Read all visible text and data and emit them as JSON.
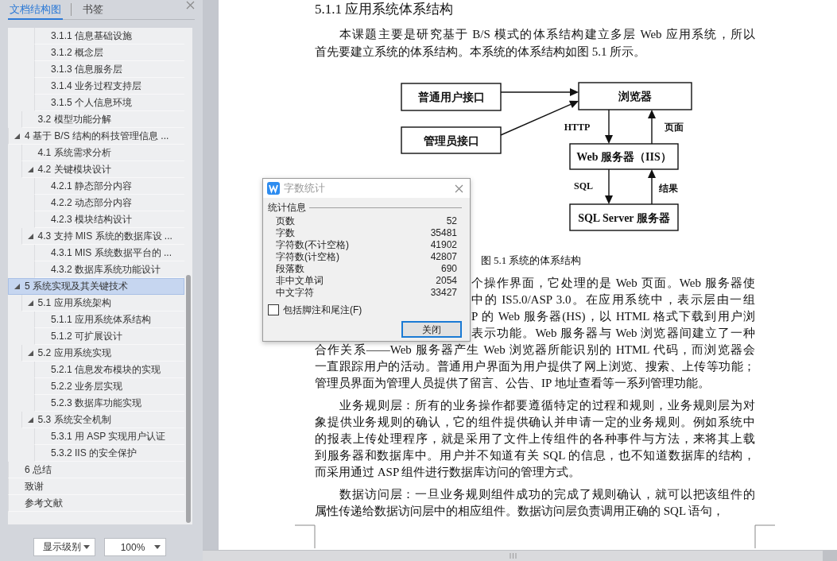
{
  "sidebar": {
    "tabs": [
      {
        "label": "文档结构图",
        "selected": true
      },
      {
        "label": "书签",
        "selected": false
      }
    ],
    "tree": [
      {
        "children": [
          {
            "children": [
              {
                "label": "3.1.1  信息基础设施",
                "selected": false
              },
              {
                "label": "3.1.2  概念层",
                "selected": false
              },
              {
                "label": "3.1.3  信息服务层",
                "selected": false
              },
              {
                "label": "3.1.4  业务过程支持层",
                "selected": false
              },
              {
                "label": "3.1.5  个人信息环境",
                "selected": false
              }
            ]
          },
          {
            "label": "3.2 模型功能分解",
            "selected": false
          }
        ]
      },
      {
        "label": "4  基于 B/S 结构的科技管理信息 ...",
        "selected": false,
        "expanded": true,
        "children": [
          {
            "label": "4.1  系统需求分析",
            "selected": false
          },
          {
            "label": "4.2  关键模块设计",
            "selected": false,
            "expanded": true,
            "children": [
              {
                "label": "4.2.1  静态部分内容",
                "selected": false
              },
              {
                "label": "4.2.2  动态部分内容",
                "selected": false
              },
              {
                "label": "4.2.3  模块结构设计",
                "selected": false
              }
            ]
          },
          {
            "label": "4.3  支持 MIS 系统的数据库设 ...",
            "selected": false,
            "expanded": true,
            "children": [
              {
                "label": "4.3.1 MIS 系统数据平台的 ...",
                "selected": false
              },
              {
                "label": "4.3.2  数据库系统功能设计",
                "selected": false
              }
            ]
          }
        ]
      },
      {
        "label": "5  系统实现及其关键技术",
        "selected": true,
        "expanded": true,
        "children": [
          {
            "label": "5.1  应用系统架构",
            "selected": false,
            "expanded": true,
            "children": [
              {
                "label": "5.1.1  应用系统体系结构",
                "selected": false
              },
              {
                "label": "5.1.2  可扩展设计",
                "selected": false
              }
            ]
          },
          {
            "label": "5.2  应用系统实现",
            "selected": false,
            "expanded": true,
            "children": [
              {
                "label": "5.2.1  信息发布模块的实现",
                "selected": false
              },
              {
                "label": "5.2.2  业务层实现",
                "selected": false
              },
              {
                "label": "5.2.3  数据库功能实现",
                "selected": false
              }
            ]
          },
          {
            "label": "5.3  系统安全机制",
            "selected": false,
            "expanded": true,
            "children": [
              {
                "label": "5.3.1  用 ASP 实现用户认证",
                "selected": false
              },
              {
                "label": "5.3.2 IIS 的安全保护",
                "selected": false
              }
            ]
          }
        ]
      },
      {
        "label": "6  总结",
        "selected": false
      },
      {
        "label": "致谢",
        "selected": false
      },
      {
        "label": "参考文献",
        "selected": false
      }
    ],
    "controls": [
      {
        "label": "显示级别"
      },
      {
        "label": "100%"
      }
    ]
  },
  "document": {
    "blocks": [
      {
        "kind": "heading",
        "text": "5.1.1  应用系统体系结构"
      },
      {
        "kind": "paragraph",
        "lines": [
          "本课题主要是研究基于 B/S 模式的体系结构建立多层 Web 应用系统，所以",
          "首先要建立系统的体系结构。本系统的体系结构如图 5.1 所示。"
        ]
      },
      {
        "kind": "figure",
        "nodes": [
          "普通用户接口",
          "管理员接口",
          "浏览器",
          "Web 服务器（IIS）",
          "SQL Server 服务器"
        ],
        "edge_labels": [
          "HTTP",
          "页面",
          "SQL",
          "结果"
        ],
        "caption": "图 5.1  系统的体系结构"
      },
      {
        "kind": "paragraph",
        "lines": [
          "个操作界面，它处理的是 Web 页面。Web 服务器使",
          "中的 IS5.0/ASP 3.0。在应用系统中，表示层由一组",
          "P 的 Web 服务器(HS)，以 HTML 格式下载到用户浏",
          "表示功能。Web 服务器与 Web 浏览器间建立了一种",
          "合作关系——Web 服务器产生 Web 浏览器所能识别的 HTML 代码，而浏览器会",
          "一直跟踪用户的活动。普通用户界面为用户提供了网上浏览、搜索、上传等功能；",
          "管理员界面为管理人员提供了留言、公告、IP 地址查看等一系列管理功能。"
        ]
      },
      {
        "kind": "paragraph",
        "lines": [
          "业务规则层：所有的业务操作都要遵循特定的过程和规则，业务规则层为对",
          "象提供业务规则的确认，它的组件提供确认并申请一定的业务规则。例如系统中",
          "的报表上传处理程序，就是采用了文件上传组件的各种事件与方法，来将其上载",
          "到服务器和数据库中。用户并不知道有关 SQL 的信息，也不知道数据库的结构，",
          "而采用通过 ASP 组件进行数据库访问的管理方式。"
        ]
      },
      {
        "kind": "paragraph",
        "lines": [
          "数据访问层：一旦业务规则组件成功的完成了规则确认，就可以把该组件的",
          "属性传递给数据访问层中的相应组件。数据访问层负责调用正确的 SQL 语句，"
        ]
      }
    ]
  },
  "dialog": {
    "title": "字数统计",
    "group": "统计信息",
    "stats": [
      {
        "label": "页数",
        "value": "52"
      },
      {
        "label": "字数",
        "value": "35481"
      },
      {
        "label": "字符数(不计空格)",
        "value": "41902"
      },
      {
        "label": "字符数(计空格)",
        "value": "42807"
      },
      {
        "label": "段落数",
        "value": "690"
      },
      {
        "label": "非中文单词",
        "value": "2054"
      },
      {
        "label": "中文字符",
        "value": "33427"
      }
    ],
    "option": {
      "label": "包括脚注和尾注(F)",
      "checked": false
    },
    "button": "关闭"
  }
}
